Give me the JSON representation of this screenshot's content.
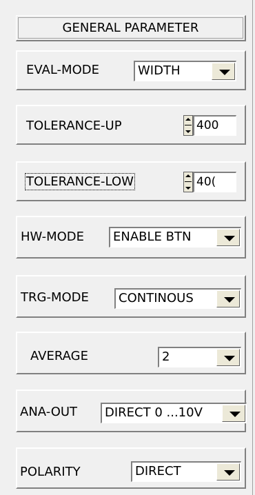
{
  "panel": {
    "title": "GENERAL PARAMETER",
    "eval_mode": {
      "label": "EVAL-MODE",
      "value": "WIDTH"
    },
    "tolerance_up": {
      "label": "TOLERANCE-UP",
      "value": "400"
    },
    "tolerance_low": {
      "label": "TOLERANCE-LOW",
      "value": "40("
    },
    "hw_mode": {
      "label": "HW-MODE",
      "value": "ENABLE BTN"
    },
    "trg_mode": {
      "label": "TRG-MODE",
      "value": "CONTINOUS"
    },
    "average": {
      "label": "AVERAGE",
      "value": "2"
    },
    "ana_out": {
      "label": "ANA-OUT",
      "value": "DIRECT 0 ...10V"
    },
    "polarity": {
      "label": "POLARITY",
      "value": "DIRECT"
    }
  },
  "icons": {
    "dropdown": "chevron-down-icon",
    "spinner": "spinner-updown-icon"
  }
}
